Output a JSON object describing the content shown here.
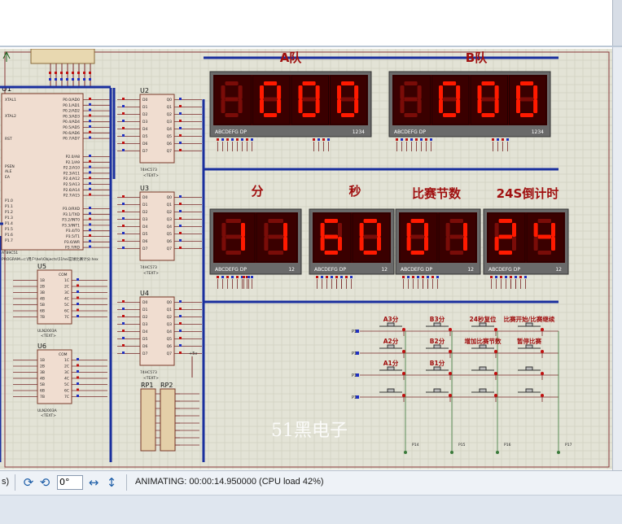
{
  "status": {
    "left_fragment": "s)",
    "rotation_value": "0°",
    "animation": "ANIMATING: 00:00:14.950000 (CPU load 42%)"
  },
  "chips": {
    "u1": {
      "ref": "U1",
      "part": "AT89C51",
      "path": "PROGRAM=c:\\用户\\hel\\Objects\\51hei篮球比赛计分.hex",
      "left_pins": [
        "XTAL1",
        "XTAL2",
        "RST",
        "PSEN",
        "ALE",
        "EA",
        "P1.0",
        "P1.1",
        "P1.2",
        "P1.3",
        "P1.4",
        "P1.5",
        "P1.6",
        "P1.7"
      ],
      "right_pins": [
        "P0.0/AD0",
        "P0.1/AD1",
        "P0.2/AD2",
        "P0.3/AD3",
        "P0.4/AD4",
        "P0.5/AD5",
        "P0.6/AD6",
        "P0.7/AD7",
        "P2.0/A8",
        "P2.1/A9",
        "P2.2/A10",
        "P2.3/A11",
        "P2.4/A12",
        "P2.5/A13",
        "P2.6/A14",
        "P2.7/A15",
        "P3.0/RXD",
        "P3.1/TXD",
        "P3.2/INT0",
        "P3.3/INT1",
        "P3.4/T0",
        "P3.5/T1",
        "P3.6/WR",
        "P3.7/RD"
      ]
    },
    "u2": {
      "ref": "U2",
      "part": "74HC573"
    },
    "u3": {
      "ref": "U3",
      "part": "74HC573"
    },
    "u4": {
      "ref": "U4",
      "part": "74HC573"
    },
    "u5": {
      "ref": "U5",
      "part": "ULN2003A"
    },
    "u6": {
      "ref": "U6",
      "part": "ULN2003A"
    },
    "rp1": "RP1",
    "rp2": "RP2",
    "text_tag": "<TEXT>",
    "com_label": "COM",
    "latch_left": [
      "D0",
      "D1",
      "D2",
      "D3",
      "D4",
      "D5",
      "D6",
      "D7"
    ],
    "latch_right": [
      "Q0",
      "Q1",
      "Q2",
      "Q3",
      "Q4",
      "Q5",
      "Q6",
      "Q7"
    ],
    "uln_left": [
      "1B",
      "2B",
      "3B",
      "4B",
      "5B",
      "6B",
      "7B"
    ],
    "uln_right": [
      "1C",
      "2C",
      "3C",
      "4C",
      "5C",
      "6C",
      "7C"
    ],
    "vcc": "+5v"
  },
  "displays": [
    {
      "id": "team-a",
      "title": "A队",
      "digits": [
        "8",
        "0",
        "0",
        "0"
      ],
      "lit": [
        false,
        true,
        true,
        true
      ],
      "seg_label": "ABCDEFG  DP",
      "pin_label": "1234"
    },
    {
      "id": "team-b",
      "title": "B队",
      "digits": [
        "8",
        "0",
        "0",
        "0"
      ],
      "lit": [
        false,
        true,
        true,
        true
      ],
      "seg_label": "ABCDEFG  DP",
      "pin_label": "1234"
    },
    {
      "id": "minutes",
      "title": "分",
      "digits": [
        "1",
        "1"
      ],
      "lit": [
        true,
        true
      ],
      "seg_label": "ABCDEFG  DP",
      "pin_label": "12"
    },
    {
      "id": "seconds",
      "title": "秒",
      "digits": [
        "6",
        "0"
      ],
      "lit": [
        true,
        true
      ],
      "seg_label": "ABCDEFG  DP",
      "pin_label": "12"
    },
    {
      "id": "section",
      "title": "比赛节数",
      "digits": [
        "0",
        "1"
      ],
      "lit": [
        true,
        true
      ],
      "seg_label": "ABCDEFG  DP",
      "pin_label": "12"
    },
    {
      "id": "shot-clock",
      "title": "24S倒计时",
      "digits": [
        "2",
        "4"
      ],
      "lit": [
        true,
        true
      ],
      "seg_label": "ABCDEFG  DP",
      "pin_label": "12"
    }
  ],
  "keypad": {
    "rows": [
      "P10",
      "P11",
      "P12",
      "P13"
    ],
    "cols": [
      "P14",
      "P15",
      "P16",
      "P17"
    ],
    "labels": [
      [
        "A3分",
        "B3分",
        "24秒复位",
        "比赛开始/比赛继续"
      ],
      [
        "A2分",
        "B2分",
        "增加比赛节数",
        "暂停比赛"
      ],
      [
        "A1分",
        "B1分",
        "",
        ""
      ],
      [
        "",
        "",
        "",
        ""
      ]
    ]
  },
  "watermark": "51黑电子",
  "colors": {
    "segment_on": "#ff1a00",
    "segment_off": "#7a0c08",
    "display_bg": "#4a0000",
    "bus": "#1a2f9e",
    "grid": "#c9c9b8",
    "canvas": "#e3e3d6",
    "title_red": "#a01010"
  }
}
